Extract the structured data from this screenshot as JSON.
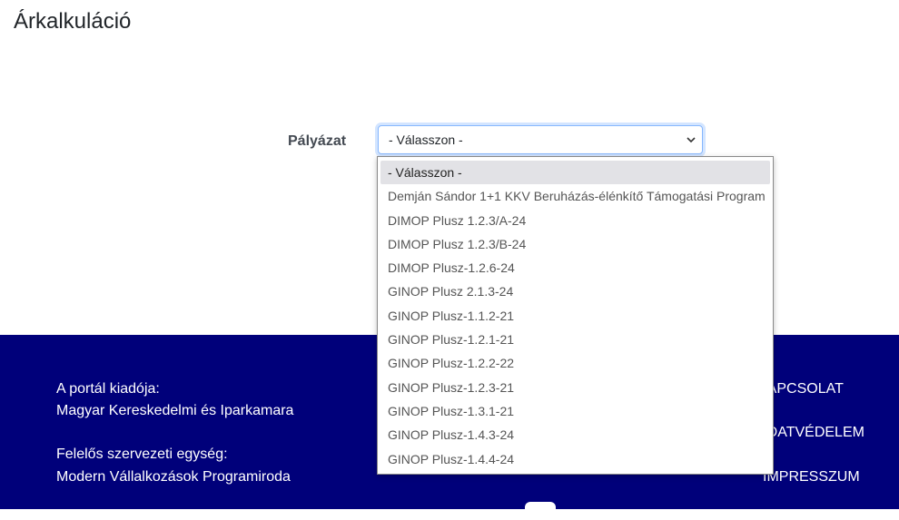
{
  "page": {
    "title": "Árkalkuláció"
  },
  "form": {
    "label": "Pályázat",
    "select_value": "- Válasszon -",
    "options": [
      "- Válasszon -",
      "Demján Sándor 1+1 KKV Beruházás-élénkítő Támogatási Program",
      "DIMOP Plusz 1.2.3/A-24",
      "DIMOP Plusz 1.2.3/B-24",
      "DIMOP Plusz-1.2.6-24",
      "GINOP Plusz 2.1.3-24",
      "GINOP Plusz-1.1.2-21",
      "GINOP Plusz-1.2.1-21",
      "GINOP Plusz-1.2.2-22",
      "GINOP Plusz-1.2.3-21",
      "GINOP Plusz-1.3.1-21",
      "GINOP Plusz-1.4.3-24",
      "GINOP Plusz-1.4.4-24"
    ],
    "selected_index": 0
  },
  "footer": {
    "publisher_label": "A portál kiadója:",
    "publisher_name": "Magyar Kereskedelmi és Iparkamara",
    "unit_label": "Felelős szervezeti egység:",
    "unit_name": "Modern Vállalkozások Programiroda",
    "links": [
      "KAPCSOLAT",
      "ADATVÉDELEM",
      "IMPRESSZUM"
    ],
    "bg_color": "#00007a"
  }
}
